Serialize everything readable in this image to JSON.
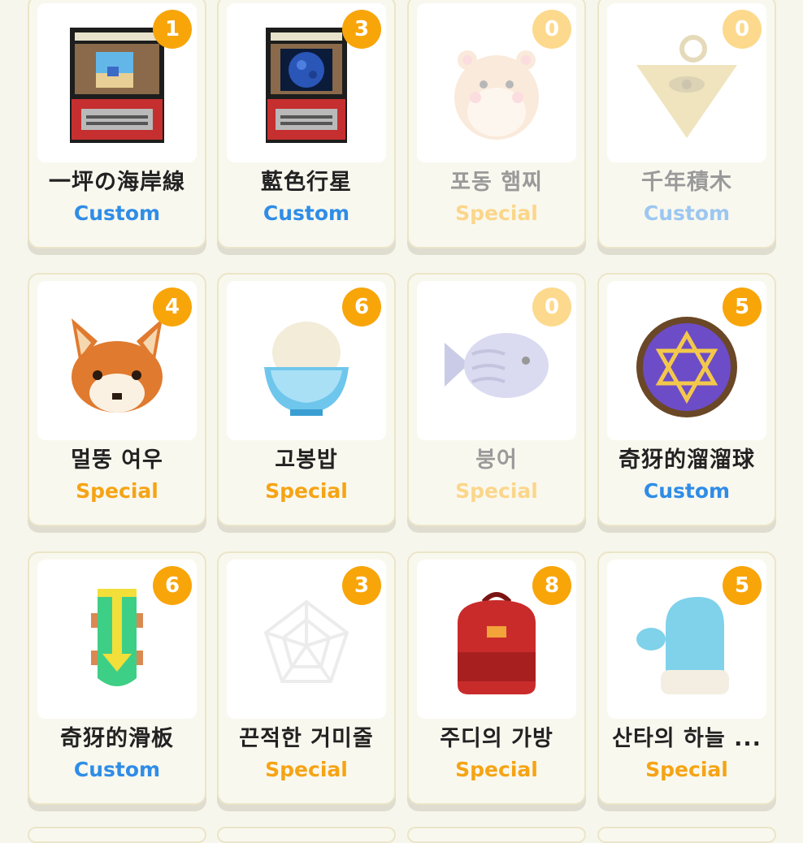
{
  "items": [
    {
      "name": "一坪の海岸線",
      "type": "Custom",
      "count": "1",
      "icon": "arcade-machine-beach-icon"
    },
    {
      "name": "藍色行星",
      "type": "Custom",
      "count": "3",
      "icon": "arcade-machine-planet-icon"
    },
    {
      "name": "포동 햄찌",
      "type": "Special",
      "count": "0",
      "icon": "hamster-icon"
    },
    {
      "name": "千年積木",
      "type": "Custom",
      "count": "0",
      "icon": "millennium-puzzle-icon"
    },
    {
      "name": "멀뚱 여우",
      "type": "Special",
      "count": "4",
      "icon": "fox-head-icon"
    },
    {
      "name": "고봉밥",
      "type": "Special",
      "count": "6",
      "icon": "rice-bowl-icon"
    },
    {
      "name": "붕어",
      "type": "Special",
      "count": "0",
      "icon": "fish-bread-icon"
    },
    {
      "name": "奇犽的溜溜球",
      "type": "Custom",
      "count": "5",
      "icon": "hexagram-yoyo-icon"
    },
    {
      "name": "奇犽的滑板",
      "type": "Custom",
      "count": "6",
      "icon": "skateboard-icon"
    },
    {
      "name": "끈적한 거미줄",
      "type": "Special",
      "count": "3",
      "icon": "spider-web-icon"
    },
    {
      "name": "주디의 가방",
      "type": "Special",
      "count": "8",
      "icon": "red-backpack-icon"
    },
    {
      "name": "산타의 하늘 ...",
      "type": "Special",
      "count": "5",
      "icon": "blue-mitten-icon"
    }
  ],
  "colors": {
    "badge": "#f8a50a",
    "custom": "#2f8de6",
    "special": "#f5a415"
  }
}
